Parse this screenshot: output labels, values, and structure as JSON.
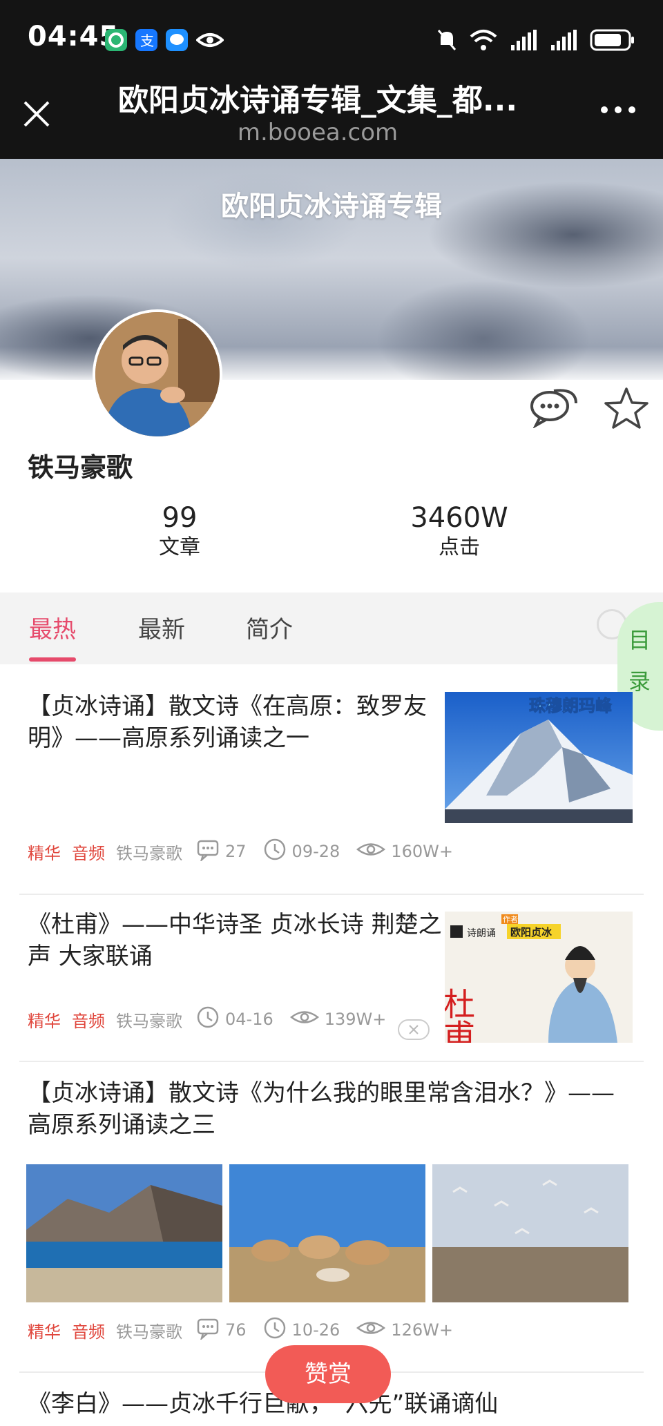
{
  "status_bar": {
    "time": "04:45",
    "icons": [
      "app-green-icon",
      "alipay-icon",
      "message-icon",
      "eye-icon",
      "mute-icon",
      "wifi-icon",
      "signal-1-icon",
      "signal-2-icon",
      "battery-icon"
    ]
  },
  "browser": {
    "title": "欧阳贞冰诗诵专辑_文集_都...",
    "domain": "m.booea.com"
  },
  "profile": {
    "banner_title": "欧阳贞冰诗诵专辑",
    "author_name": "铁马豪歌",
    "stats": [
      {
        "value": "99",
        "label": "文章"
      },
      {
        "value": "3460W",
        "label": "点击"
      }
    ]
  },
  "tabs": [
    {
      "label": "最热",
      "active": true
    },
    {
      "label": "最新",
      "active": false
    },
    {
      "label": "简介",
      "active": false
    }
  ],
  "toc": {
    "char1": "目",
    "char2": "录"
  },
  "articles": [
    {
      "title": "【贞冰诗诵】散文诗《在高原：致罗友明》——高原系列诵读之一",
      "tags": [
        "精华",
        "音频"
      ],
      "author": "铁马豪歌",
      "comments": "27",
      "date": "09-28",
      "views": "160W+",
      "thumb_caption": "珠穆朗玛峰"
    },
    {
      "title": "《杜甫》——中华诗圣 贞冰长诗 荆楚之声 大家联诵",
      "tags": [
        "精华",
        "音频"
      ],
      "author": "铁马豪歌",
      "date": "04-16",
      "views": "139W+",
      "thumb_brand": "诗朗诵",
      "thumb_author": "欧阳贞冰",
      "thumb_badge": "作者",
      "thumb_name": "杜甫"
    },
    {
      "title": "【贞冰诗诵】散文诗《为什么我的眼里常含泪水？》——高原系列诵读之三",
      "tags": [
        "精华",
        "音频"
      ],
      "author": "铁马豪歌",
      "comments": "76",
      "date": "10-26",
      "views": "126W+"
    },
    {
      "title": "《李白》——贞冰千行巨献，“六先”联诵谪仙"
    }
  ],
  "reward_button": "赞赏",
  "colors": {
    "accent": "#e64a6b",
    "tag": "#e0463c",
    "reward": "#f25b56",
    "toc_bg": "#d6f3d3"
  }
}
